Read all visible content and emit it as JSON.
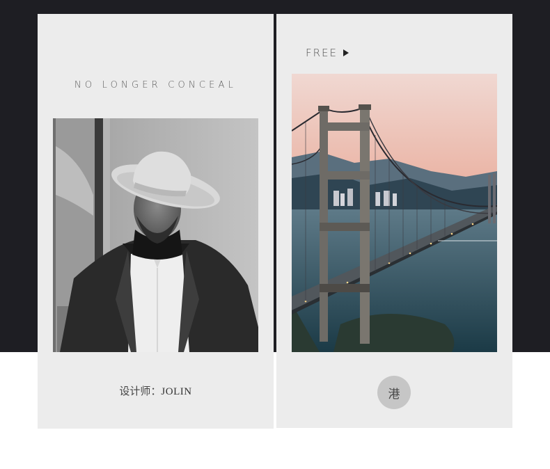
{
  "left_card": {
    "tagline": "NO LONGER CONCEAL",
    "designer_label": "设计师：",
    "designer_name": "JOLIN"
  },
  "right_card": {
    "free_label": "FREE",
    "free_icon": "play-icon",
    "badge_text": "港"
  },
  "colors": {
    "dark_band": "#1e1e23",
    "card_bg": "#ececec",
    "badge_bg": "#c6c6c6"
  }
}
